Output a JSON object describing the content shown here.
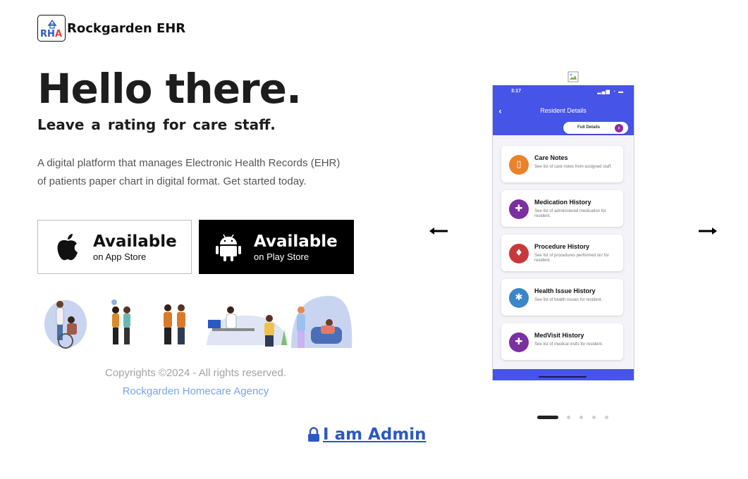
{
  "brand": {
    "logo_letters": "RHA",
    "name": "Rockgarden EHR"
  },
  "hero": {
    "title": "Hello there.",
    "subtitle": "Leave a rating for care staff.",
    "description": "A digital platform that manages Electronic Health Records (EHR) of patients paper chart in digital format. Get started today."
  },
  "stores": {
    "apple": {
      "big": "Available",
      "small": "on App Store",
      "icon": "apple-icon"
    },
    "play": {
      "big": "Available",
      "small": "on Play Store",
      "icon": "android-icon"
    }
  },
  "footer": {
    "copyright": "Copyrights ©2024 - All rights reserved.",
    "company": "Rockgarden Homecare Agency"
  },
  "admin_link": {
    "label": "I am Admin",
    "icon": "lock-icon"
  },
  "carousel": {
    "prev_icon": "arrow-left-icon",
    "next_icon": "arrow-right-icon",
    "active_slide": 1,
    "slide_count": 5,
    "phone": {
      "time": "3:17",
      "screen_title": "Resident Details",
      "full_details": "Full Details",
      "accent": "#4654e8",
      "cards": [
        {
          "title": "Care Notes",
          "desc": "See list of care notes from assigned staff.",
          "color": "#e9822a",
          "icon": "notes-icon"
        },
        {
          "title": "Medication History",
          "desc": "See list of administered medication for resident.",
          "color": "#7b2fa0",
          "icon": "medication-icon"
        },
        {
          "title": "Procedure History",
          "desc": "See list of procedures performed on/ for resident.",
          "color": "#c8383b",
          "icon": "procedure-icon"
        },
        {
          "title": "Health Issue History",
          "desc": "See list of health issues for resident.",
          "color": "#3a86c8",
          "icon": "health-icon"
        },
        {
          "title": "MedVisit History",
          "desc": "See list of medical visits for resident.",
          "color": "#7b2fa0",
          "icon": "medvisit-icon"
        }
      ]
    }
  }
}
